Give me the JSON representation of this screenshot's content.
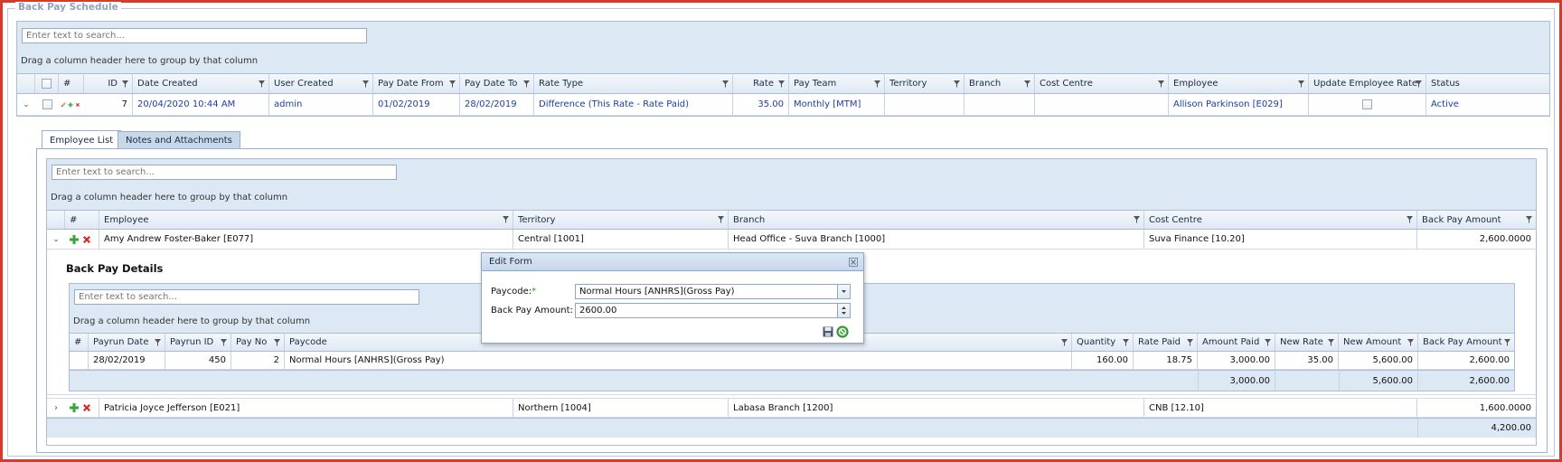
{
  "section_title": "Back Pay Schedule",
  "search_placeholder": "Enter text to search...",
  "group_hint": "Drag a column header here to group by that column",
  "main_grid": {
    "columns": [
      "#",
      "ID",
      "Date Created",
      "User Created",
      "Pay Date From",
      "Pay Date To",
      "Rate Type",
      "Rate",
      "Pay Team",
      "Territory",
      "Branch",
      "Cost Centre",
      "Employee",
      "Update Employee Rate",
      "Status"
    ],
    "row": {
      "id": "7",
      "date_created": "20/04/2020 10:44 AM",
      "user_created": "admin",
      "pay_date_from": "01/02/2019",
      "pay_date_to": "28/02/2019",
      "rate_type": "Difference (This Rate - Rate Paid)",
      "rate": "35.00",
      "pay_team": "Monthly [MTM]",
      "territory": "",
      "branch": "",
      "cost_centre": "",
      "employee": "Allison Parkinson [E029]",
      "status": "Active"
    }
  },
  "tabs": [
    "Employee List",
    "Notes and Attachments"
  ],
  "employee_grid": {
    "columns": [
      "#",
      "Employee",
      "Territory",
      "Branch",
      "Cost Centre",
      "Back Pay Amount"
    ],
    "rows": [
      {
        "employee": "Amy Andrew Foster-Baker [E077]",
        "territory": "Central [1001]",
        "branch": "Head Office - Suva Branch [1000]",
        "cost_centre": "Suva Finance [10.20]",
        "amount": "2,600.0000"
      },
      {
        "employee": "Patricia Joyce Jefferson [E021]",
        "territory": "Northern [1004]",
        "branch": "Labasa Branch [1200]",
        "cost_centre": "CNB [12.10]",
        "amount": "1,600.0000"
      }
    ],
    "total": "4,200.00"
  },
  "details": {
    "title": "Back Pay Details",
    "columns": [
      "#",
      "Payrun Date",
      "Payrun ID",
      "Pay No",
      "Paycode",
      "Quantity",
      "Rate Paid",
      "Amount Paid",
      "New Rate",
      "New Amount",
      "Back Pay Amount"
    ],
    "row": {
      "payrun_date": "28/02/2019",
      "payrun_id": "450",
      "pay_no": "2",
      "paycode": "Normal Hours [ANHRS](Gross Pay)",
      "quantity": "160.00",
      "rate_paid": "18.75",
      "amount_paid": "3,000.00",
      "new_rate": "35.00",
      "new_amount": "5,600.00",
      "back_pay_amount": "2,600.00"
    },
    "totals": {
      "amount_paid": "3,000.00",
      "new_amount": "5,600.00",
      "back_pay_amount": "2,600.00"
    }
  },
  "edit_form": {
    "title": "Edit Form",
    "paycode_label": "Paycode:",
    "required_mark": "*",
    "paycode_value": "Normal Hours [ANHRS](Gross Pay)",
    "amount_label": "Back Pay Amount:",
    "amount_value": "2600.00"
  },
  "colors": {
    "accent": "#1a3fa0",
    "frame": "#d63a2a",
    "panel": "#dde8f5"
  }
}
